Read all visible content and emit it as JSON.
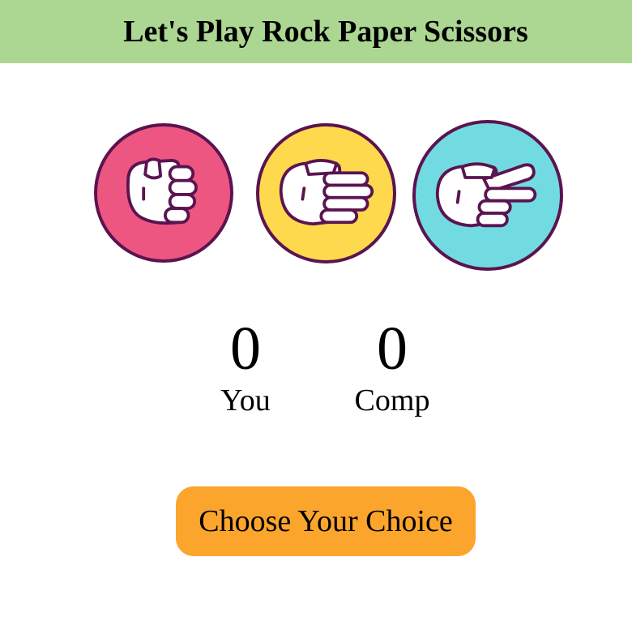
{
  "header": {
    "title": "Let's Play Rock Paper Scissors"
  },
  "choices": [
    {
      "id": "rock",
      "icon": "rock-hand-icon",
      "color": "#ee5682"
    },
    {
      "id": "paper",
      "icon": "paper-hand-icon",
      "color": "#fed94e"
    },
    {
      "id": "scissors",
      "icon": "scissors-hand-icon",
      "color": "#72dbe1"
    }
  ],
  "score": {
    "you": {
      "value": "0",
      "label": "You"
    },
    "comp": {
      "value": "0",
      "label": "Comp"
    }
  },
  "message": {
    "text": "Choose Your Choice",
    "color": "#fba52d"
  },
  "colors": {
    "header_bg": "#acd792",
    "outline": "#5a1450"
  }
}
